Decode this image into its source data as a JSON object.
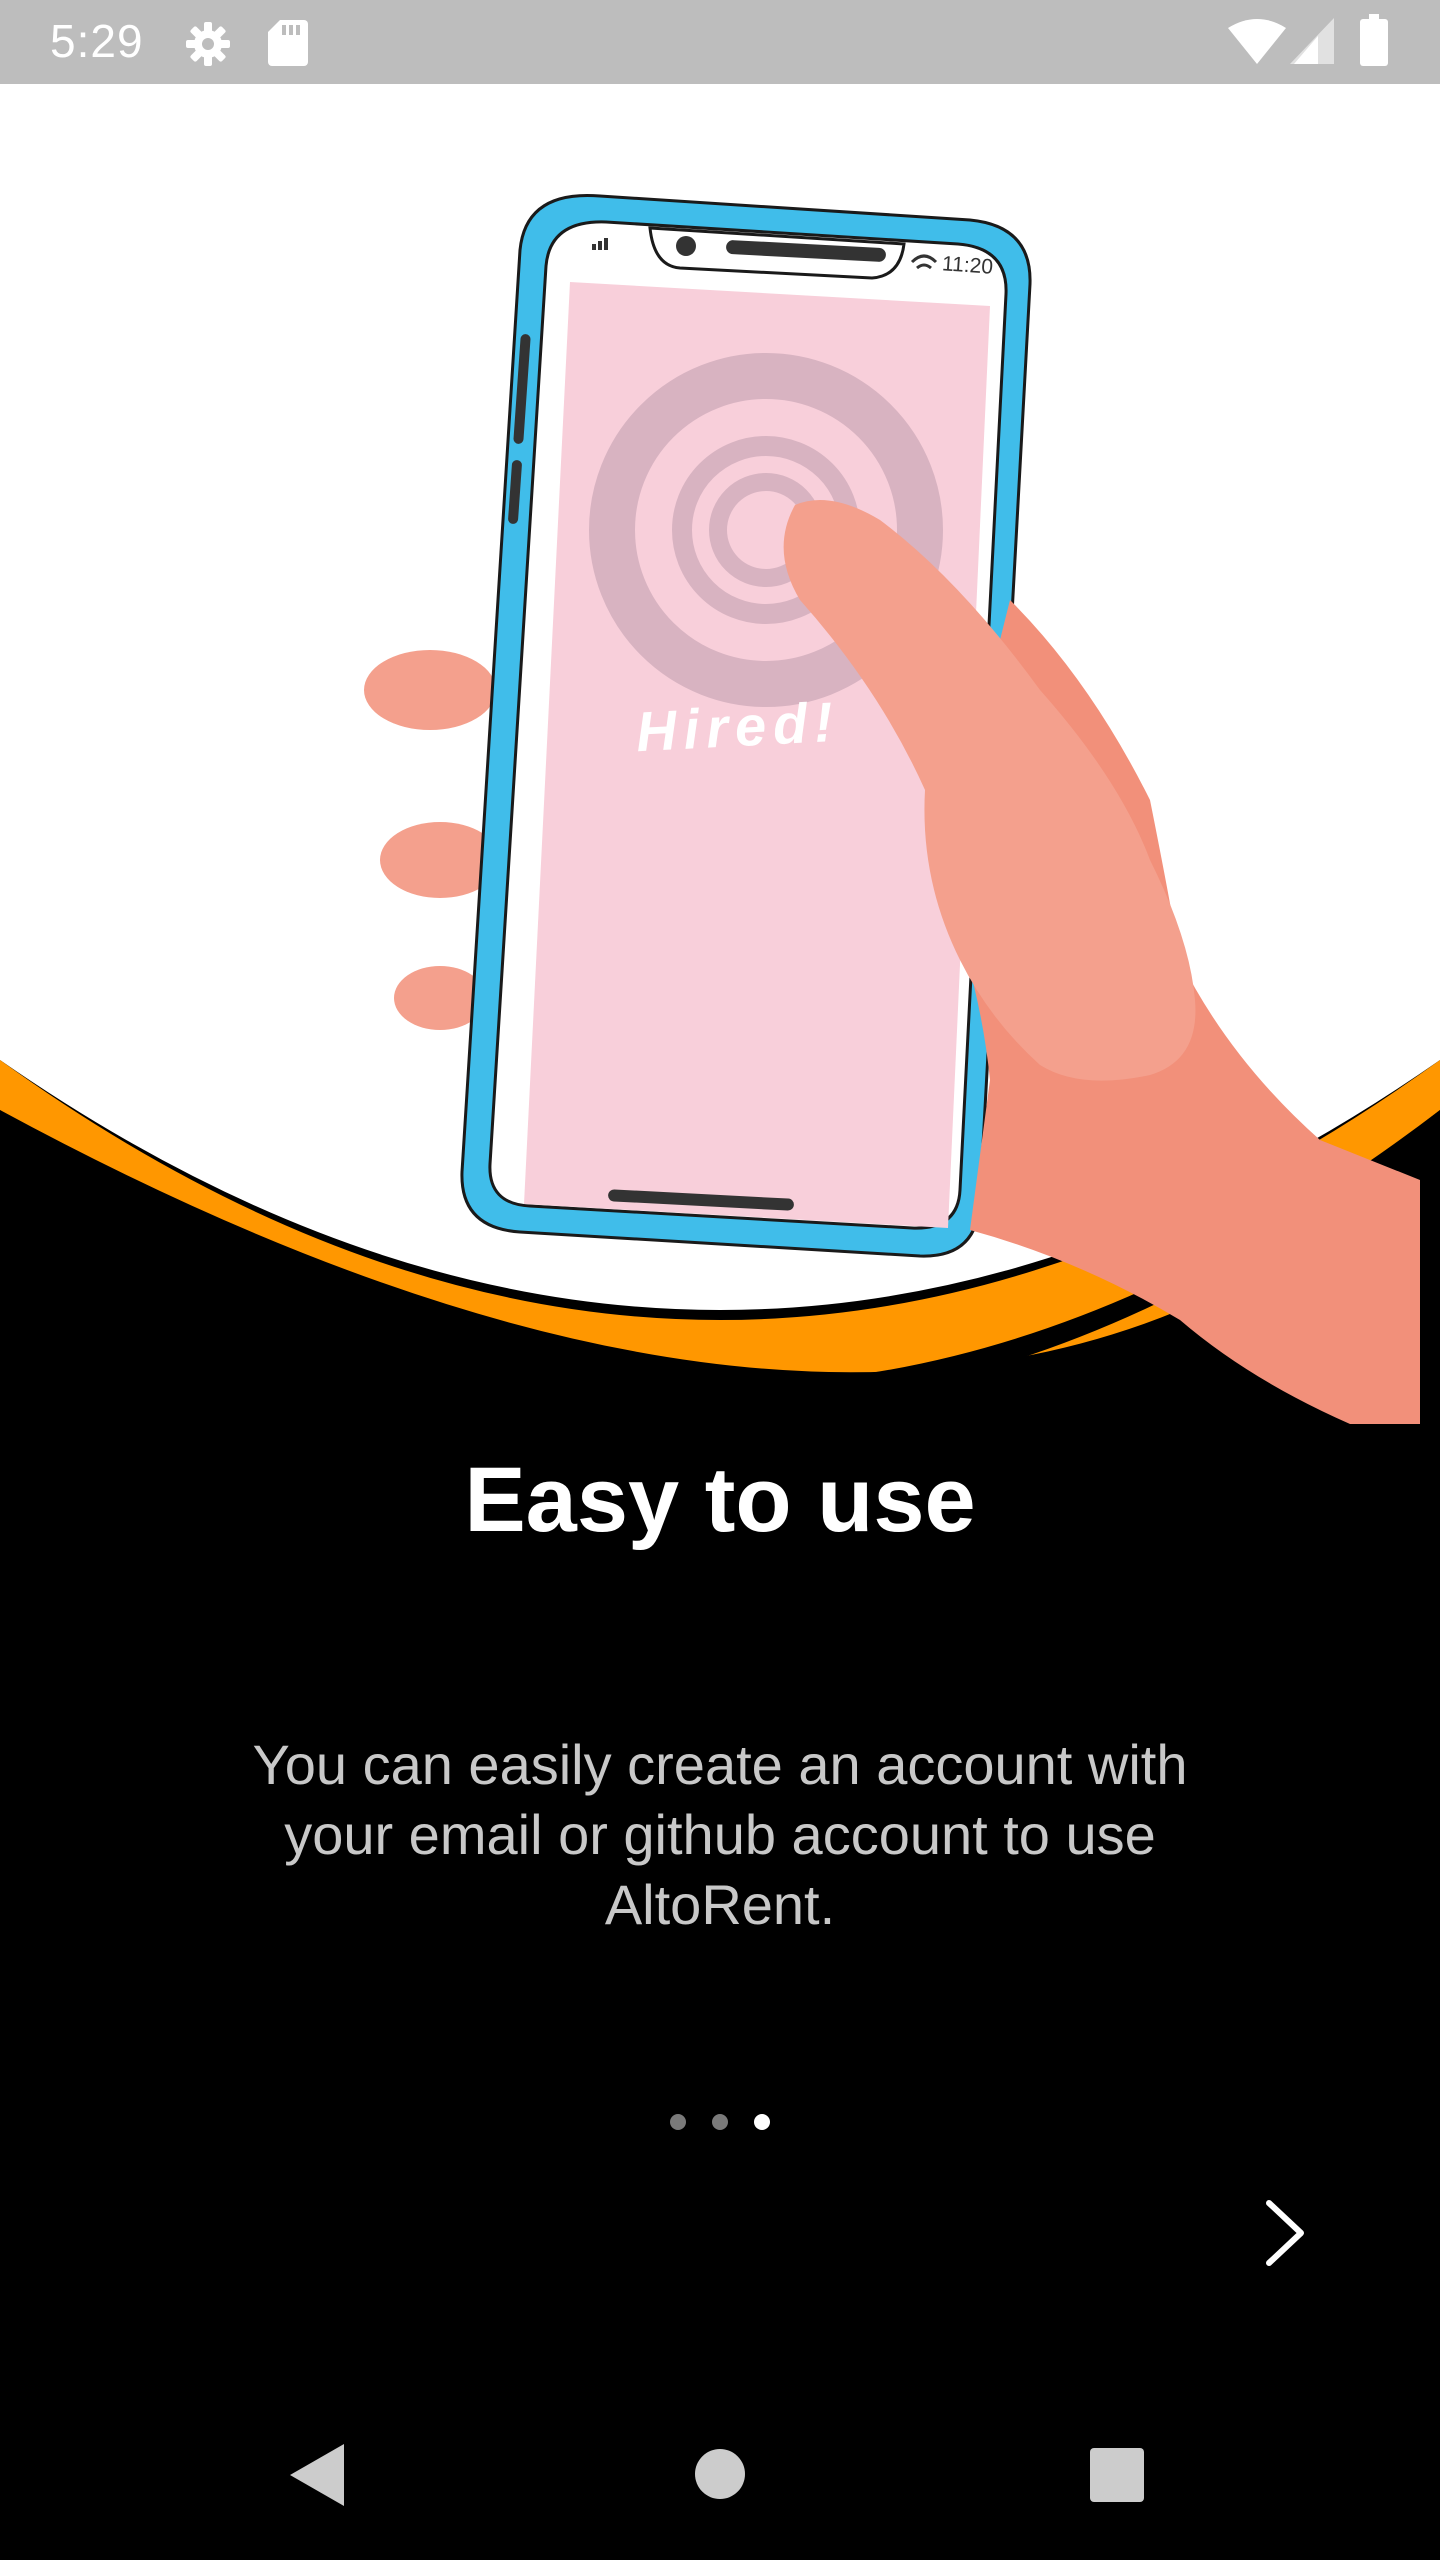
{
  "status_bar": {
    "time": "5:29",
    "icons": [
      "settings-icon",
      "sd-card-icon",
      "wifi-icon",
      "cell-signal-icon",
      "battery-icon"
    ],
    "background": "#bdbdbd"
  },
  "illustration": {
    "phone_time": "11:20",
    "phone_label": "Hired!",
    "colors": {
      "phone_frame": "#40bdea",
      "phone_screen": "#f8cfda",
      "accent_wave": "#ff9700",
      "skin": "#f4a08d"
    }
  },
  "onboarding": {
    "title": "Easy to use",
    "description": "You can easily create an account with your email or github account to use AltoRent.",
    "page_count": 3,
    "current_page": 3
  },
  "controls": {
    "next_icon": "chevron-right-icon"
  },
  "nav_bar": {
    "icons": [
      "back-icon",
      "home-icon",
      "recents-icon"
    ]
  }
}
